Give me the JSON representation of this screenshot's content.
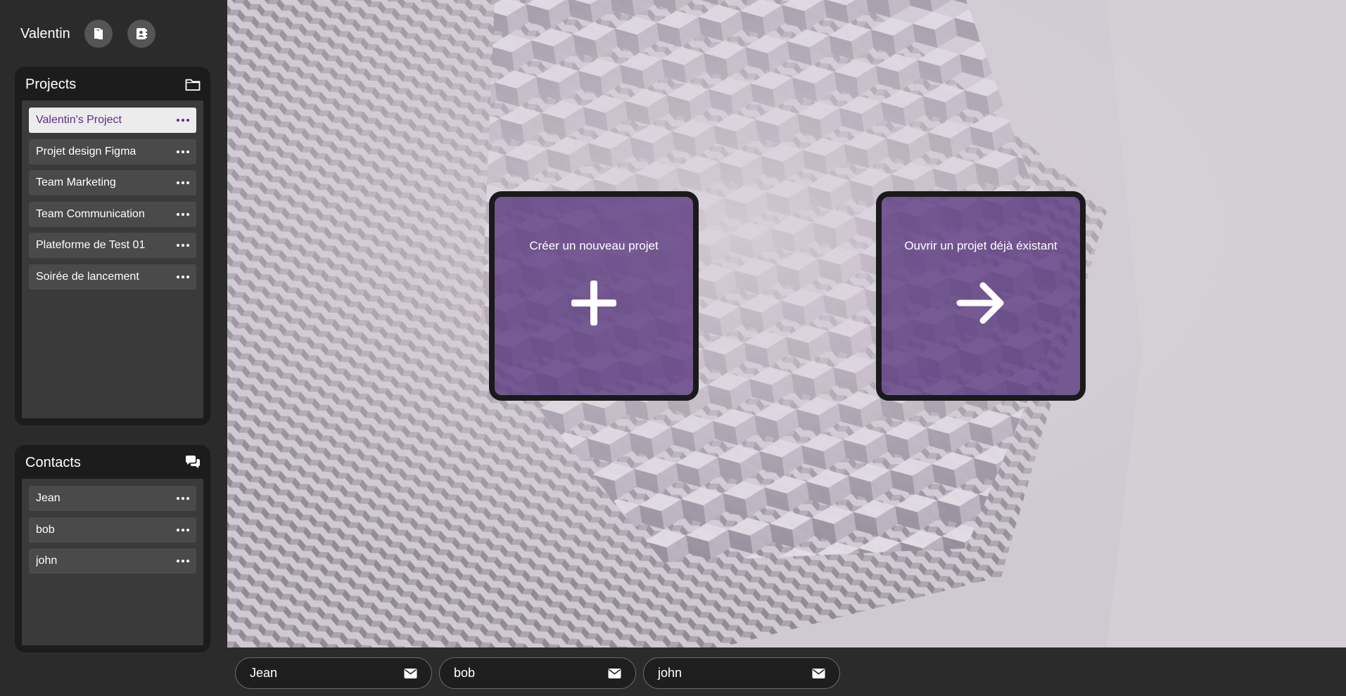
{
  "user": {
    "name": "Valentin"
  },
  "projects": {
    "title": "Projects",
    "items": [
      {
        "label": "Valentin's Project",
        "active": true
      },
      {
        "label": "Projet design Figma"
      },
      {
        "label": "Team Marketing"
      },
      {
        "label": "Team Communication"
      },
      {
        "label": "Plateforme de Test 01"
      },
      {
        "label": "Soirée de lancement"
      }
    ]
  },
  "contacts": {
    "title": "Contacts",
    "items": [
      {
        "label": "Jean"
      },
      {
        "label": "bob"
      },
      {
        "label": "john"
      }
    ]
  },
  "main": {
    "create_card": {
      "title": "Créer un nouveau projet",
      "icon": "plus-icon"
    },
    "open_card": {
      "title": "Ouvrir un projet déjà éxistant",
      "icon": "arrow-right-icon"
    }
  },
  "chat_tabs": [
    {
      "label": "Jean",
      "icon": "envelope-icon"
    },
    {
      "label": "bob",
      "icon": "envelope-icon"
    },
    {
      "label": "john",
      "icon": "envelope-icon"
    }
  ],
  "colors": {
    "accent": "#5b2d86",
    "card_overlay": "#58377d",
    "sidebar_bg": "#2b2b2b",
    "panel_bg": "#1c1c1c"
  }
}
